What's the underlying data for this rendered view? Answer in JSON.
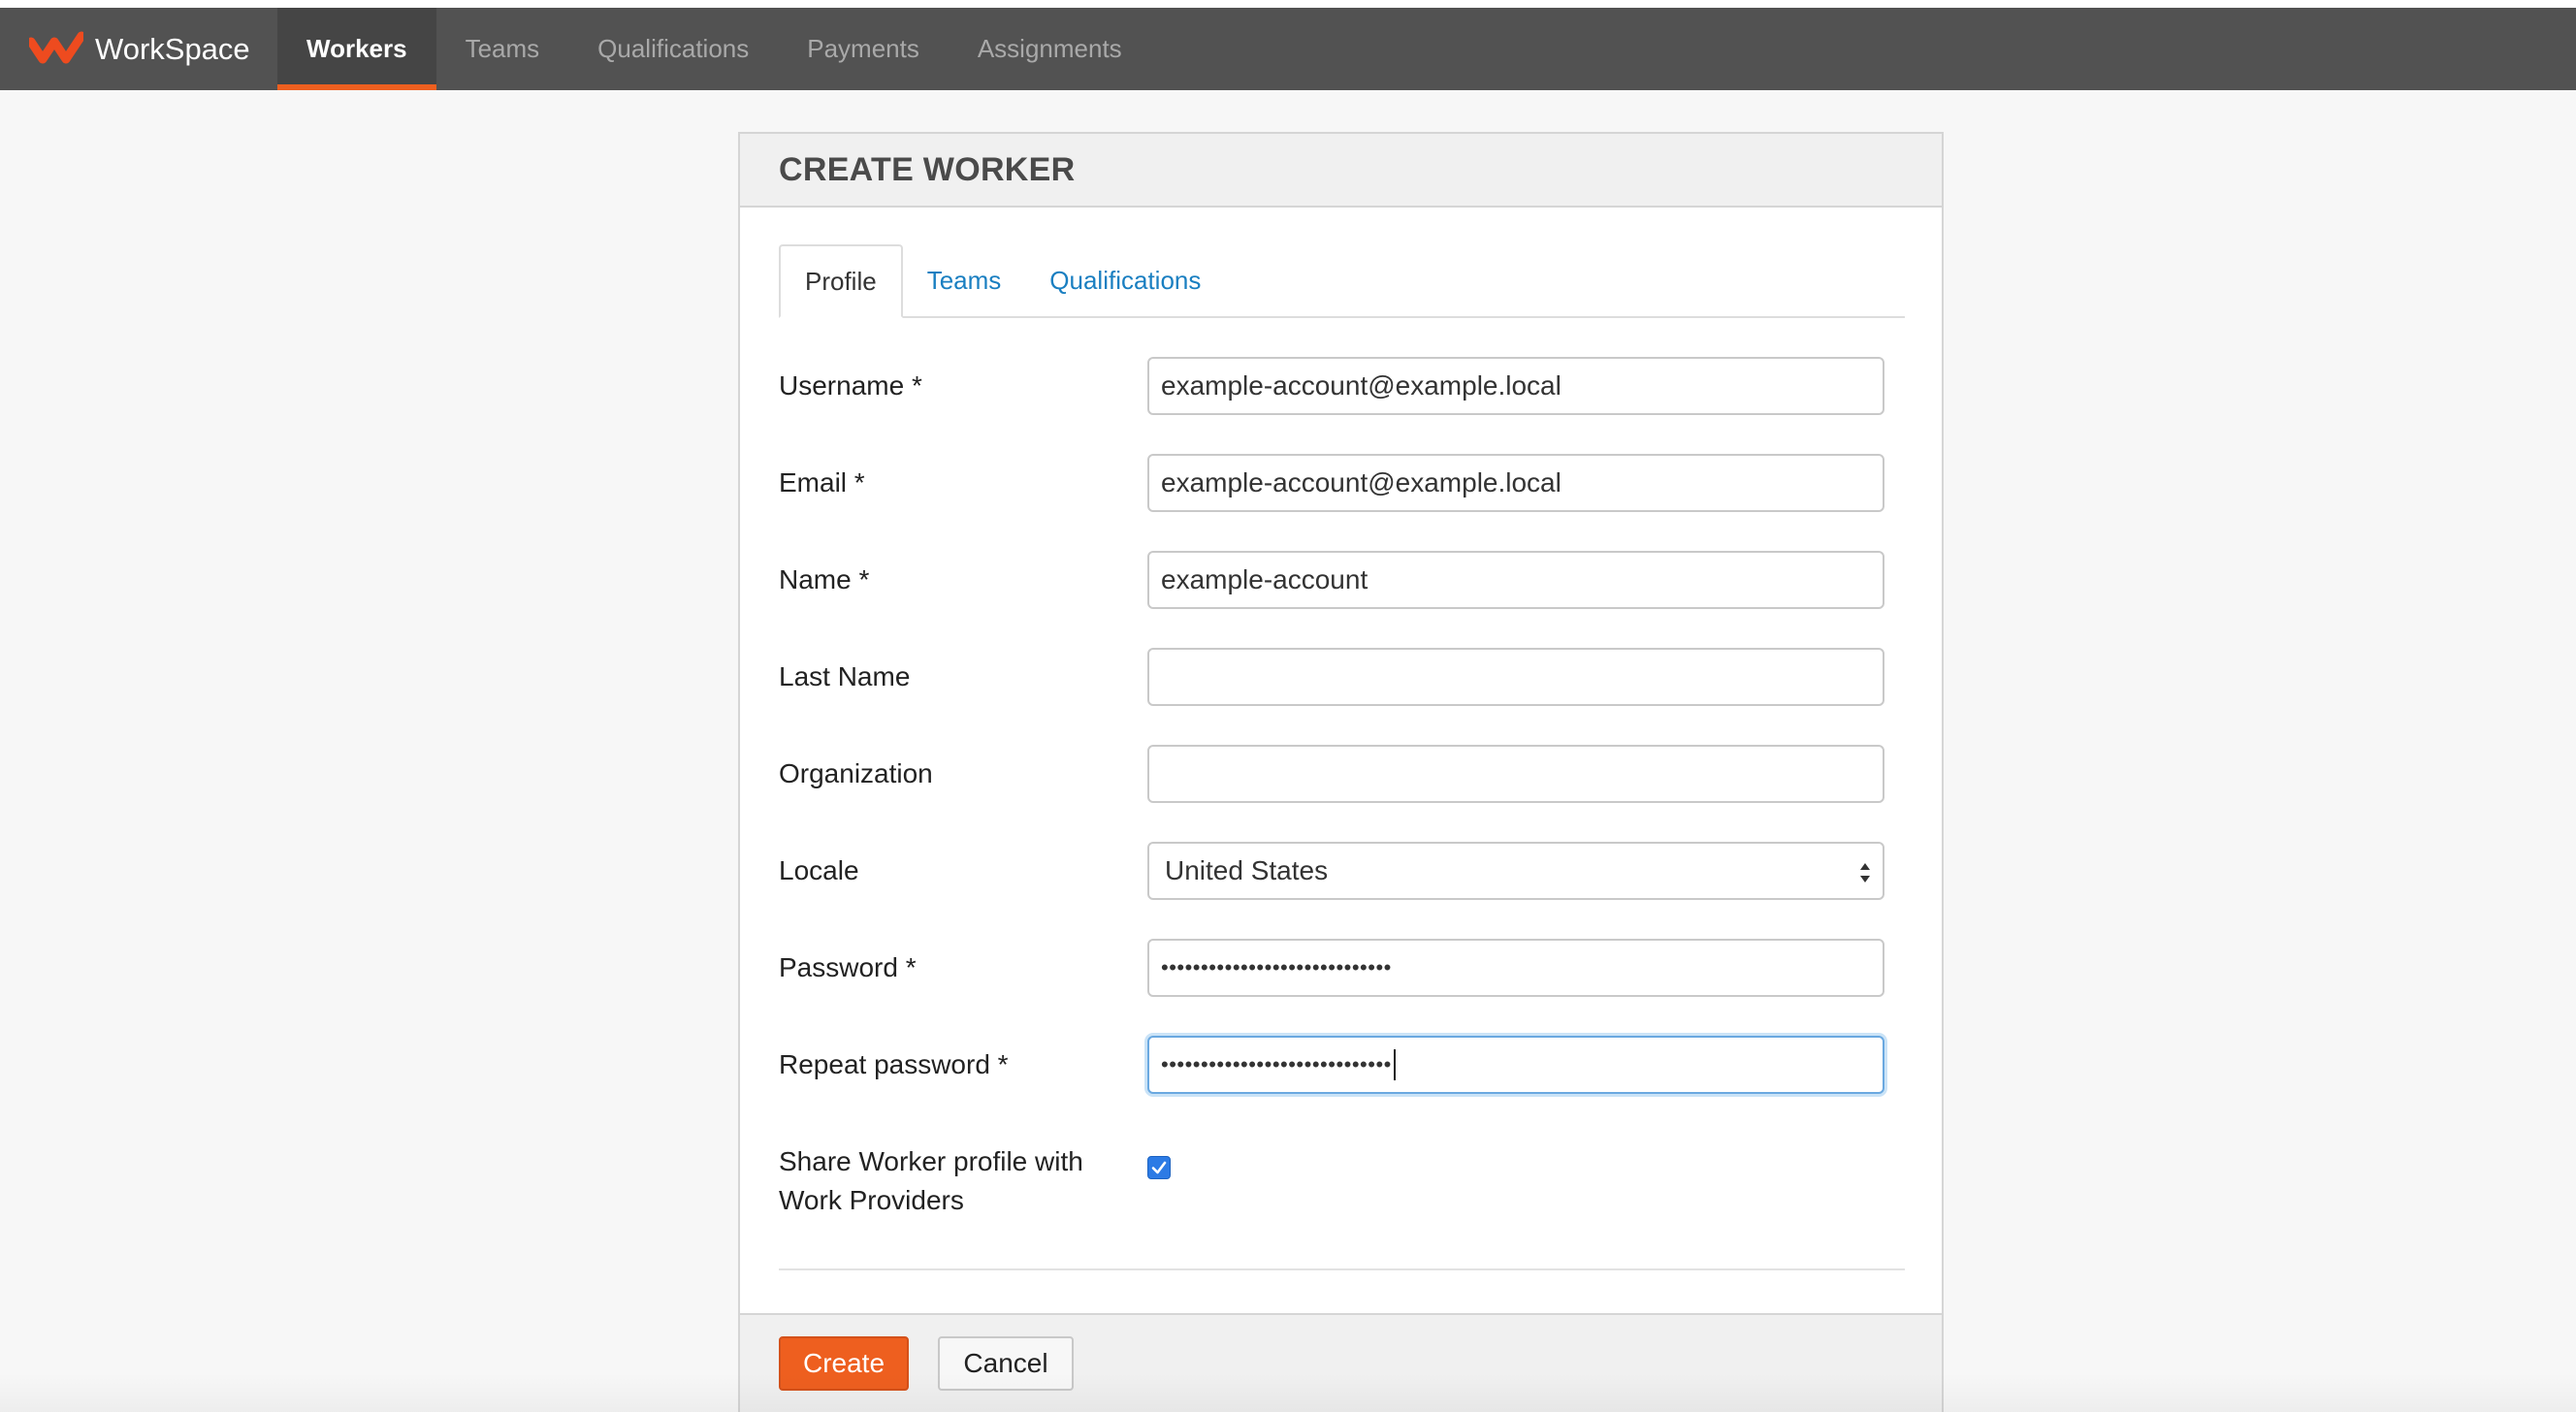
{
  "navbar": {
    "brand_text": "WorkSpace",
    "items": [
      {
        "label": "Workers",
        "active": true
      },
      {
        "label": "Teams",
        "active": false
      },
      {
        "label": "Qualifications",
        "active": false
      },
      {
        "label": "Payments",
        "active": false
      },
      {
        "label": "Assignments",
        "active": false
      }
    ]
  },
  "panel": {
    "title": "CREATE WORKER",
    "tabs": [
      {
        "label": "Profile",
        "active": true
      },
      {
        "label": "Teams",
        "active": false
      },
      {
        "label": "Qualifications",
        "active": false
      }
    ]
  },
  "form": {
    "username": {
      "label": "Username *",
      "value": "example-account@example.local"
    },
    "email": {
      "label": "Email *",
      "value": "example-account@example.local"
    },
    "name": {
      "label": "Name *",
      "value": "example-account"
    },
    "last_name": {
      "label": "Last Name",
      "value": ""
    },
    "organization": {
      "label": "Organization",
      "value": ""
    },
    "locale": {
      "label": "Locale",
      "value": "United States"
    },
    "password": {
      "label": "Password *",
      "value": "•••••••••••••••••••••••••••••"
    },
    "repeat_password": {
      "label": "Repeat password *",
      "value": "•••••••••••••••••••••••••••••"
    },
    "share_profile": {
      "label_line1": "Share Worker profile with",
      "label_line2": "Work Providers",
      "checked": true
    }
  },
  "footer": {
    "create_label": "Create",
    "cancel_label": "Cancel"
  },
  "colors": {
    "accent": "#ee5f1f",
    "navbar": "#525252",
    "link": "#1a7fc1",
    "checkbox": "#2c7be5"
  },
  "icons": {
    "brand": "workspace-logo-icon",
    "select": "select-updown-icon",
    "check": "checkmark-icon"
  }
}
